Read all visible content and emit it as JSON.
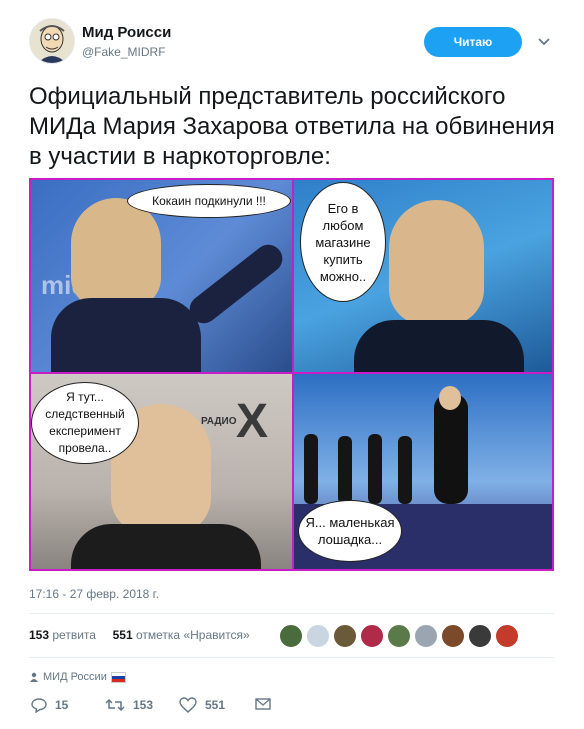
{
  "header": {
    "display_name": "Мид Роисси",
    "handle": "@Fake_MIDRF",
    "follow_label": "Читаю"
  },
  "tweet": {
    "text": "Официальный представитель российского МИДа Мария Захарова ответила на обвинения в участии в наркоторговле:",
    "timestamp": "17:16 - 27 февр. 2018 г."
  },
  "media": {
    "panels": [
      {
        "bubble": "Кокаин подкинули !!!",
        "backdrop_text": "mid"
      },
      {
        "bubble": "Его в любом магазине купить можно.."
      },
      {
        "bubble": "Я тут... следственный експеримент провела..",
        "backdrop_text": "РАДИО"
      },
      {
        "bubble": "Я... маленькая лошадка..."
      }
    ]
  },
  "stats": {
    "retweets_count": "153",
    "retweets_label": "ретвита",
    "likes_count": "551",
    "likes_label": "отметка «Нравится»"
  },
  "likers": [
    {
      "color": "#4a6b3c"
    },
    {
      "color": "#c9d6e2"
    },
    {
      "color": "#6b5a3a"
    },
    {
      "color": "#b02a4a"
    },
    {
      "color": "#5a7a4a"
    },
    {
      "color": "#9aa5b1"
    },
    {
      "color": "#7a4a2a"
    },
    {
      "color": "#3a3a3a"
    },
    {
      "color": "#c23b2b"
    }
  ],
  "footer": {
    "related_account": "МИД России"
  },
  "actions": {
    "replies": "15",
    "retweets": "153",
    "likes": "551"
  },
  "colors": {
    "accent": "#1da1f2",
    "muted": "#657786",
    "media_border": "#c81ec8"
  }
}
